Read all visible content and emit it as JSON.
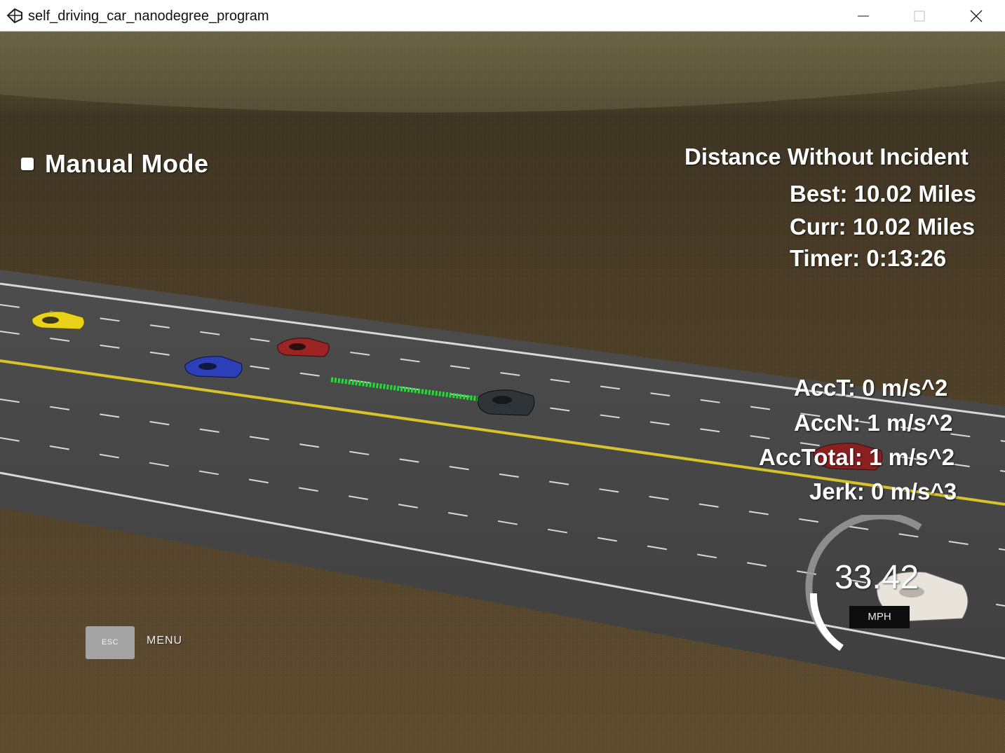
{
  "window": {
    "title": "self_driving_car_nanodegree_program",
    "app_icon": "unity-icon",
    "controls": [
      "minimize-icon",
      "maximize-icon",
      "close-icon"
    ]
  },
  "hud": {
    "mode_label": "Manual Mode",
    "distance_title": "Distance Without Incident",
    "best": "Best: 10.02 Miles",
    "curr": "Curr: 10.02 Miles",
    "timer": "Timer: 0:13:26",
    "acct": "AccT: 0 m/s^2",
    "accn": "AccN: 1 m/s^2",
    "acctotal": "AccTotal: 1 m/s^2",
    "jerk": "Jerk: 0 m/s^3"
  },
  "speedometer": {
    "value": "33.42",
    "unit": "MPH"
  },
  "menu": {
    "esc_label": "ESC",
    "menu_label": "MENU"
  },
  "colors": {
    "ground": "#5a4a30",
    "road": "#4a4a4a",
    "yellow_line": "#d6c22a",
    "path": "#22dd33"
  }
}
